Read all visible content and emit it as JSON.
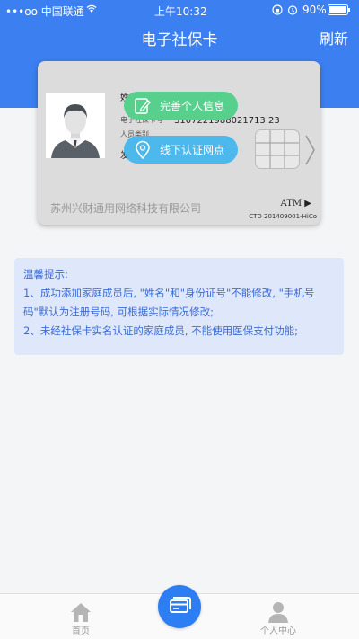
{
  "status_bar": {
    "carrier": "•••oo 中国联通",
    "time": "上午10:32",
    "battery": "90%"
  },
  "nav": {
    "title": "电子社保卡",
    "refresh_label": "刷新"
  },
  "card": {
    "name_label": "姓",
    "id_label": "电子社保卡号",
    "id_number": "3107221988021713 23",
    "row3_label": "人员类别",
    "row4_label": "发",
    "company": "苏州兴财通用网络科技有限公司",
    "atm_label": "ATM ▶",
    "ctd_code": "CTD 201409001-HiCo"
  },
  "actions": {
    "complete_info": "完善个人信息",
    "offline_points": "线下认证网点"
  },
  "notice": {
    "title": "温馨提示:",
    "line1": "1、成功添加家庭成员后, \"姓名\"和\"身份证号\"不能修改, \"手机号码\"默认为注册号码, 可根据实际情况修改;",
    "line2": "2、未经社保卡实名认证的家庭成员, 不能使用医保支付功能;"
  },
  "tabbar": {
    "home_label": "首页",
    "profile_label": "个人中心"
  },
  "colors": {
    "primary": "#3b7ff0",
    "green": "#56d08c",
    "blue": "#4cb8ec",
    "notice_bg": "#dfe8fb",
    "notice_text": "#3a6bd6"
  },
  "icons": {
    "wifi": "wifi-icon",
    "lock": "rotation-lock-icon",
    "alarm": "alarm-icon",
    "battery": "battery-icon",
    "edit": "edit-icon",
    "location": "location-pin-icon",
    "home": "home-icon",
    "card": "card-icon",
    "user": "user-icon"
  }
}
